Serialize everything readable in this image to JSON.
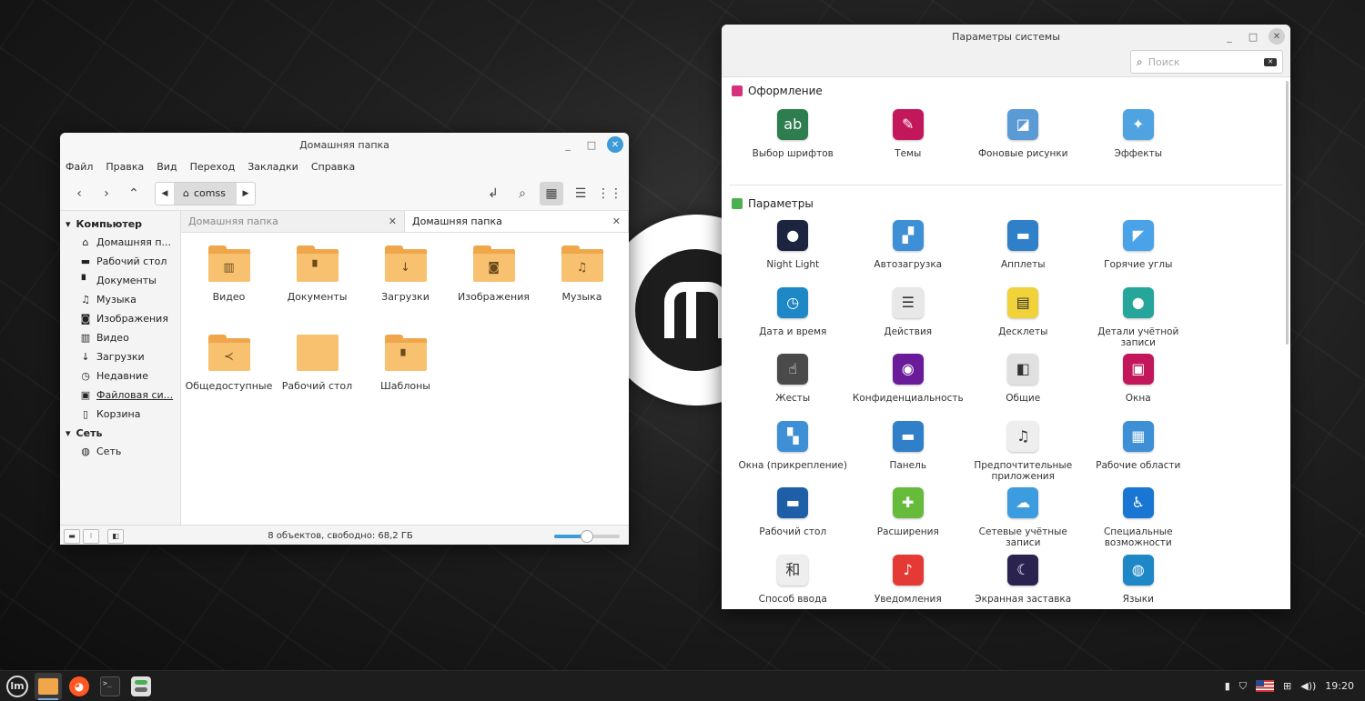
{
  "file_manager": {
    "title": "Домашняя папка",
    "menu": [
      "Файл",
      "Правка",
      "Вид",
      "Переход",
      "Закладки",
      "Справка"
    ],
    "path_crumb": "comss",
    "sidebar": {
      "computer_header": "Компьютер",
      "items": [
        {
          "label": "Домашняя п...",
          "icon": "home-icon",
          "glyph": "⌂"
        },
        {
          "label": "Рабочий стол",
          "icon": "desktop-icon",
          "glyph": "▬"
        },
        {
          "label": "Документы",
          "icon": "document-icon",
          "glyph": "▘"
        },
        {
          "label": "Музыка",
          "icon": "music-icon",
          "glyph": "♫"
        },
        {
          "label": "Изображения",
          "icon": "camera-icon",
          "glyph": "◙"
        },
        {
          "label": "Видео",
          "icon": "film-icon",
          "glyph": "▥"
        },
        {
          "label": "Загрузки",
          "icon": "download-icon",
          "glyph": "↓"
        },
        {
          "label": "Недавние",
          "icon": "clock-icon",
          "glyph": "◷"
        },
        {
          "label": "Файловая си...",
          "icon": "drive-icon",
          "glyph": "▣"
        },
        {
          "label": "Корзина",
          "icon": "trash-icon",
          "glyph": "▯"
        }
      ],
      "network_header": "Сеть",
      "network_items": [
        {
          "label": "Сеть",
          "icon": "globe-icon",
          "glyph": "◍"
        }
      ]
    },
    "tabs": [
      {
        "label": "Домашняя папка",
        "active": false
      },
      {
        "label": "Домашняя папка",
        "active": true
      }
    ],
    "files": [
      {
        "name": "Видео",
        "emblem": "film-icon",
        "glyph": "▥"
      },
      {
        "name": "Документы",
        "emblem": "document-icon",
        "glyph": "▘"
      },
      {
        "name": "Загрузки",
        "emblem": "download-icon",
        "glyph": "↓"
      },
      {
        "name": "Изображения",
        "emblem": "camera-icon",
        "glyph": "◙"
      },
      {
        "name": "Музыка",
        "emblem": "music-icon",
        "glyph": "♫"
      },
      {
        "name": "Общедоступные",
        "emblem": "share-icon",
        "glyph": "≺"
      },
      {
        "name": "Рабочий стол",
        "emblem": "",
        "glyph": ""
      },
      {
        "name": "Шаблоны",
        "emblem": "template-icon",
        "glyph": "▘"
      }
    ],
    "status": "8 объектов, свободно: 68,2 ГБ",
    "zoom_level": 0.5
  },
  "settings": {
    "title": "Параметры системы",
    "search_placeholder": "Поиск",
    "sections": [
      {
        "title": "Оформление",
        "icon": "appearance-icon",
        "color": "#d6317a",
        "items": [
          {
            "label": "Выбор шрифтов",
            "icon": "font-icon",
            "bg": "#2e7d4e",
            "glyph": "ab"
          },
          {
            "label": "Темы",
            "icon": "themes-icon",
            "bg": "#c2185b",
            "glyph": "✎"
          },
          {
            "label": "Фоновые рисунки",
            "icon": "wallpaper-icon",
            "bg": "#5b9bd5",
            "glyph": "◪"
          },
          {
            "label": "Эффекты",
            "icon": "effects-icon",
            "bg": "#4ea3e0",
            "glyph": "✦"
          }
        ]
      },
      {
        "title": "Параметры",
        "icon": "preferences-icon",
        "color": "#4caf50",
        "items": [
          {
            "label": "Night Light",
            "icon": "night-light-icon",
            "bg": "#1c2540",
            "glyph": "●"
          },
          {
            "label": "Автозагрузка",
            "icon": "startup-icon",
            "bg": "#3d8fd6",
            "glyph": "▞"
          },
          {
            "label": "Апплеты",
            "icon": "applets-icon",
            "bg": "#2f80c8",
            "glyph": "▬"
          },
          {
            "label": "Горячие углы",
            "icon": "hot-corners-icon",
            "bg": "#4aa3e8",
            "glyph": "◤"
          },
          {
            "label": "Дата и время",
            "icon": "clock-icon",
            "bg": "#1e88c7",
            "glyph": "◷"
          },
          {
            "label": "Действия",
            "icon": "actions-icon",
            "bg": "#e8e8e8",
            "glyph": "☰"
          },
          {
            "label": "Десклеты",
            "icon": "desklets-icon",
            "bg": "#f2d23a",
            "glyph": "▤"
          },
          {
            "label": "Детали учётной записи",
            "icon": "account-icon",
            "bg": "#26a69a",
            "glyph": "●"
          },
          {
            "label": "Жесты",
            "icon": "gestures-icon",
            "bg": "#4a4a4a",
            "glyph": "☝"
          },
          {
            "label": "Конфиденциальность",
            "icon": "privacy-icon",
            "bg": "#6a1b9a",
            "glyph": "◉"
          },
          {
            "label": "Общие",
            "icon": "general-icon",
            "bg": "#e0e0e0",
            "glyph": "◧"
          },
          {
            "label": "Окна",
            "icon": "windows-icon",
            "bg": "#c2185b",
            "glyph": "▣"
          },
          {
            "label": "Окна (прикрепление)",
            "icon": "window-tiling-icon",
            "bg": "#3d8fd6",
            "glyph": "▚"
          },
          {
            "label": "Панель",
            "icon": "panel-icon",
            "bg": "#2f80c8",
            "glyph": "▬"
          },
          {
            "label": "Предпочтительные приложения",
            "icon": "preferred-apps-icon",
            "bg": "#eeeeee",
            "glyph": "♫"
          },
          {
            "label": "Рабочие области",
            "icon": "workspaces-icon",
            "bg": "#3d8fd6",
            "glyph": "▦"
          },
          {
            "label": "Рабочий стол",
            "icon": "desktop-icon",
            "bg": "#1e5fa8",
            "glyph": "▬"
          },
          {
            "label": "Расширения",
            "icon": "extensions-icon",
            "bg": "#66bb3a",
            "glyph": "✚"
          },
          {
            "label": "Сетевые учётные записи",
            "icon": "online-accounts-icon",
            "bg": "#3d9be0",
            "glyph": "☁"
          },
          {
            "label": "Специальные возможности",
            "icon": "accessibility-icon",
            "bg": "#1976d2",
            "glyph": "♿"
          },
          {
            "label": "Способ ввода",
            "icon": "input-method-icon",
            "bg": "#eeeeee",
            "glyph": "和"
          },
          {
            "label": "Уведомления",
            "icon": "notifications-icon",
            "bg": "#e53935",
            "glyph": "♪"
          },
          {
            "label": "Экранная заставка",
            "icon": "screensaver-icon",
            "bg": "#2a2350",
            "glyph": "☾"
          },
          {
            "label": "Языки",
            "icon": "languages-icon",
            "bg": "#1e88c7",
            "glyph": "◍"
          }
        ]
      }
    ]
  },
  "panel": {
    "apps": [
      {
        "name": "menu-logo-icon",
        "glyph": "lm"
      },
      {
        "name": "files-app-icon",
        "glyph": "",
        "color": "#f0a64a",
        "active": true
      },
      {
        "name": "firefox-icon",
        "glyph": "◕",
        "color": "#ff5722"
      },
      {
        "name": "terminal-icon",
        "glyph": ">_",
        "color": "#2b2b2b"
      },
      {
        "name": "settings-app-icon",
        "glyph": "◧",
        "color": "#e0e0e0"
      }
    ],
    "clock": "19:20"
  }
}
